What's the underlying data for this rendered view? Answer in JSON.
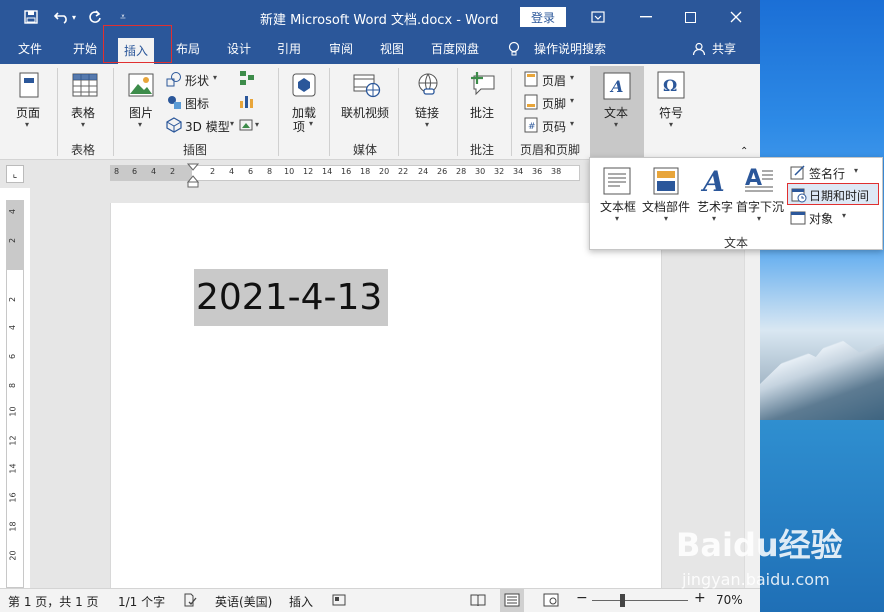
{
  "window": {
    "title": "新建 Microsoft Word 文档.docx  -  Word",
    "login": "登录"
  },
  "tabs": [
    {
      "label": "文件"
    },
    {
      "label": "开始"
    },
    {
      "label": "插入"
    },
    {
      "label": "布局"
    },
    {
      "label": "设计"
    },
    {
      "label": "引用"
    },
    {
      "label": "审阅"
    },
    {
      "label": "视图"
    },
    {
      "label": "百度网盘"
    },
    {
      "label": "操作说明搜索"
    },
    {
      "label": "共享"
    }
  ],
  "ribbon": {
    "page": "页面",
    "table": "表格",
    "table_group": "表格",
    "picture": "图片",
    "shape": "形状",
    "icon": "图标",
    "model3d": "3D 模型",
    "illus_group": "插图",
    "addin": "加载",
    "addin2": "项",
    "online_video": "联机视频",
    "media_group": "媒体",
    "link": "链接",
    "comment": "批注",
    "comment_group": "批注",
    "header": "页眉",
    "footer": "页脚",
    "page_number": "页码",
    "hf_group": "页眉和页脚",
    "text": "文本",
    "symbol": "符号"
  },
  "text_panel": {
    "textbox": "文本框",
    "quickparts": "文档部件",
    "wordart": "艺术字",
    "dropcap": "首字下沉",
    "signature": "签名行",
    "datetime": "日期和时间",
    "object": "对象",
    "group_label": "文本"
  },
  "ruler": {
    "numbers": [
      "8",
      "6",
      "4",
      "2",
      "2",
      "4",
      "6",
      "8",
      "10",
      "12",
      "14",
      "16",
      "18",
      "20",
      "22",
      "24",
      "26",
      "28",
      "30",
      "32",
      "34",
      "36",
      "38"
    ],
    "vnumbers": [
      "4",
      "2",
      "2",
      "4",
      "6",
      "8",
      "10",
      "12",
      "14",
      "16",
      "18",
      "20"
    ]
  },
  "document": {
    "date": "2021-4-13"
  },
  "status": {
    "page": "第 1 页，共 1 页",
    "words": "1/1 个字",
    "language": "英语(美国)",
    "mode": "插入",
    "zoom": "70%"
  },
  "watermark": {
    "main": "Baidu经验",
    "sub": "jingyan.baidu.com"
  }
}
